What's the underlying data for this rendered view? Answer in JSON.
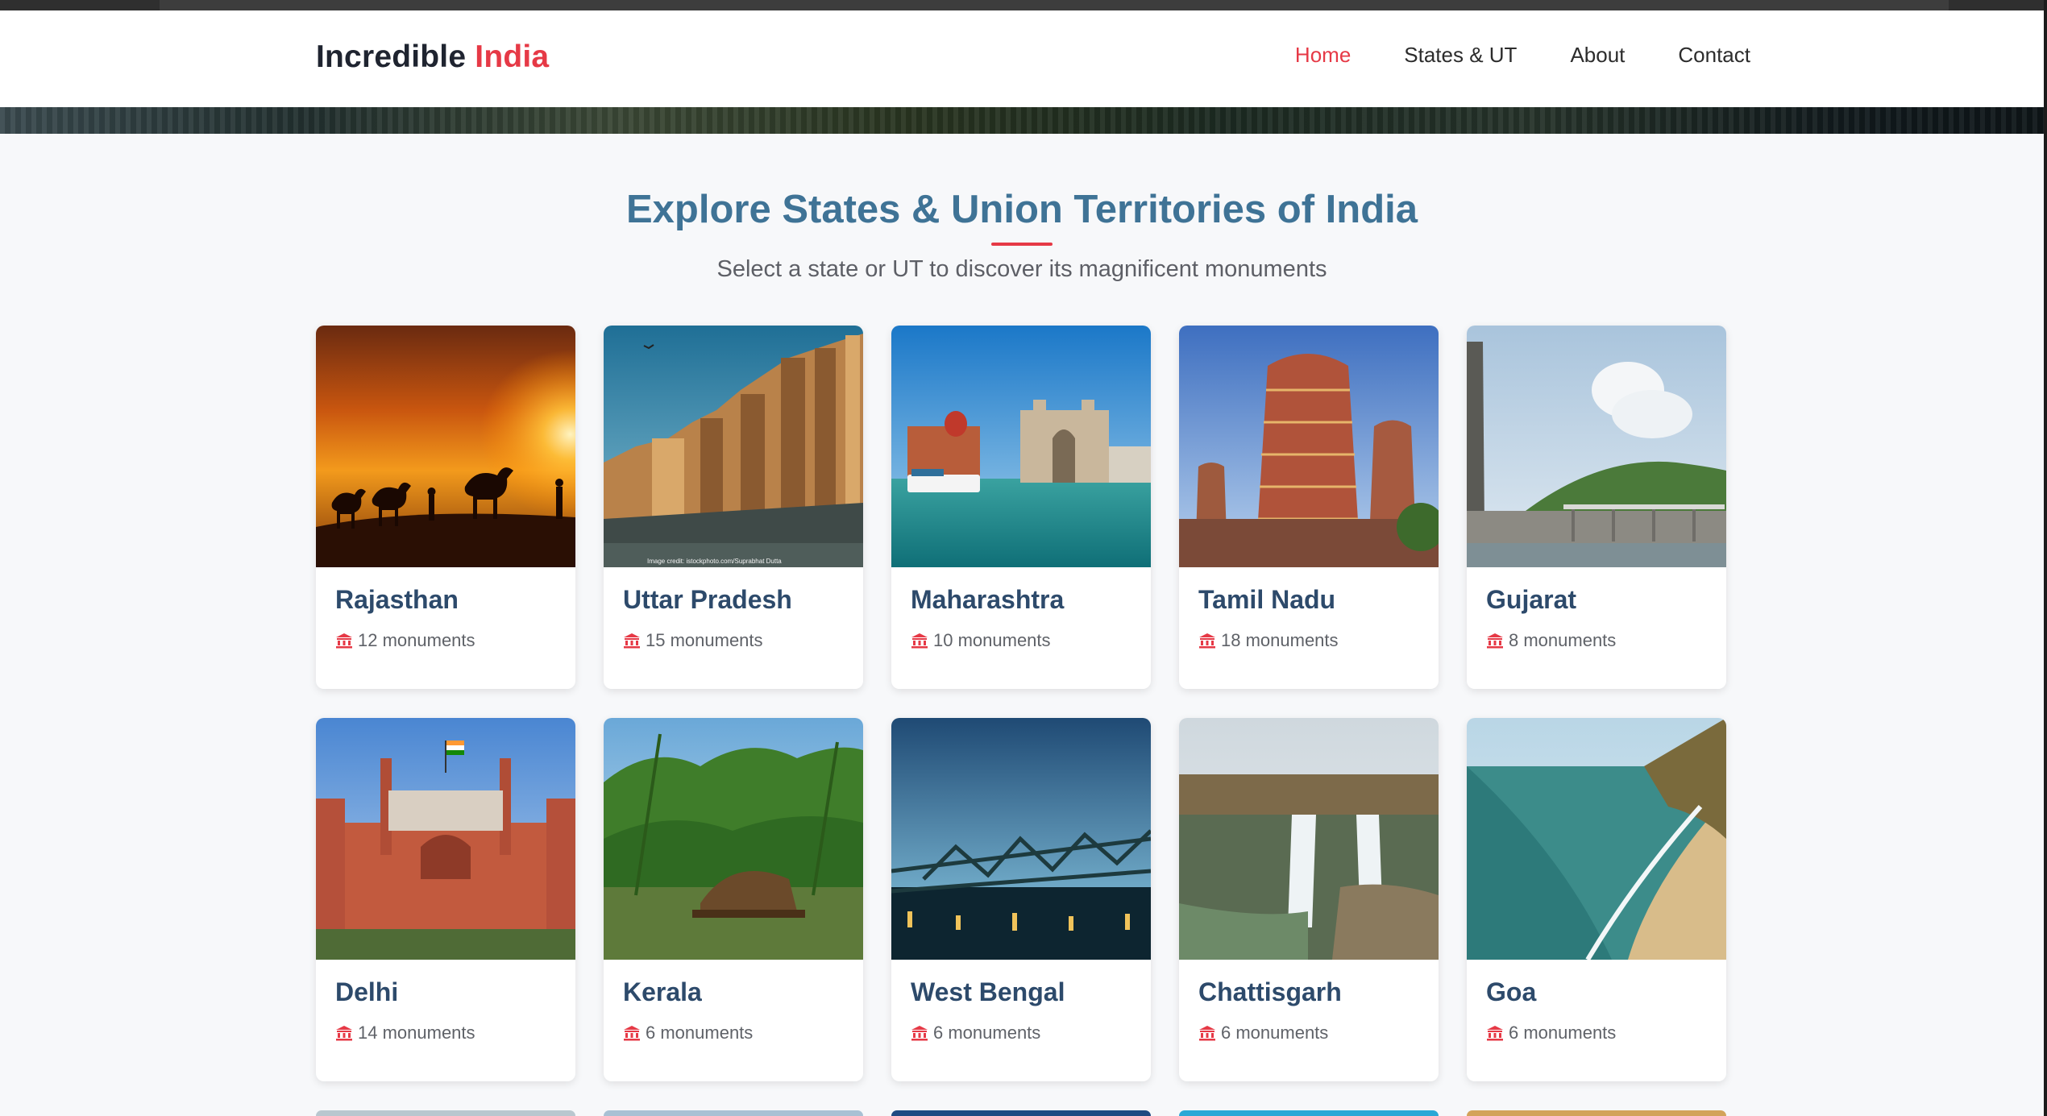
{
  "brand": {
    "text": "Incredible",
    "accent": "India"
  },
  "nav": [
    {
      "label": "Home",
      "active": true
    },
    {
      "label": "States & UT",
      "active": false
    },
    {
      "label": "About",
      "active": false
    },
    {
      "label": "Contact",
      "active": false
    }
  ],
  "section": {
    "title": "Explore States & Union Territories of India",
    "subtitle": "Select a state or UT to discover its magnificent monuments"
  },
  "icons": {
    "monument": "landmark-icon"
  },
  "colors": {
    "accent": "#e63946",
    "title": "#3f7396",
    "card_title": "#2d4a6b"
  },
  "cards": [
    {
      "name": "Rajasthan",
      "monuments": "12 monuments",
      "image_caption": ""
    },
    {
      "name": "Uttar Pradesh",
      "monuments": "15 monuments",
      "image_caption": "Image credit: istockphoto.com/Suprabhat Dutta"
    },
    {
      "name": "Maharashtra",
      "monuments": "10 monuments",
      "image_caption": ""
    },
    {
      "name": "Tamil Nadu",
      "monuments": "18 monuments",
      "image_caption": ""
    },
    {
      "name": "Gujarat",
      "monuments": "8 monuments",
      "image_caption": ""
    },
    {
      "name": "Delhi",
      "monuments": "14 monuments",
      "image_caption": ""
    },
    {
      "name": "Kerala",
      "monuments": "6 monuments",
      "image_caption": ""
    },
    {
      "name": "West Bengal",
      "monuments": "6 monuments",
      "image_caption": ""
    },
    {
      "name": "Chattisgarh",
      "monuments": "6 monuments",
      "image_caption": ""
    },
    {
      "name": "Goa",
      "monuments": "6 monuments",
      "image_caption": ""
    }
  ]
}
